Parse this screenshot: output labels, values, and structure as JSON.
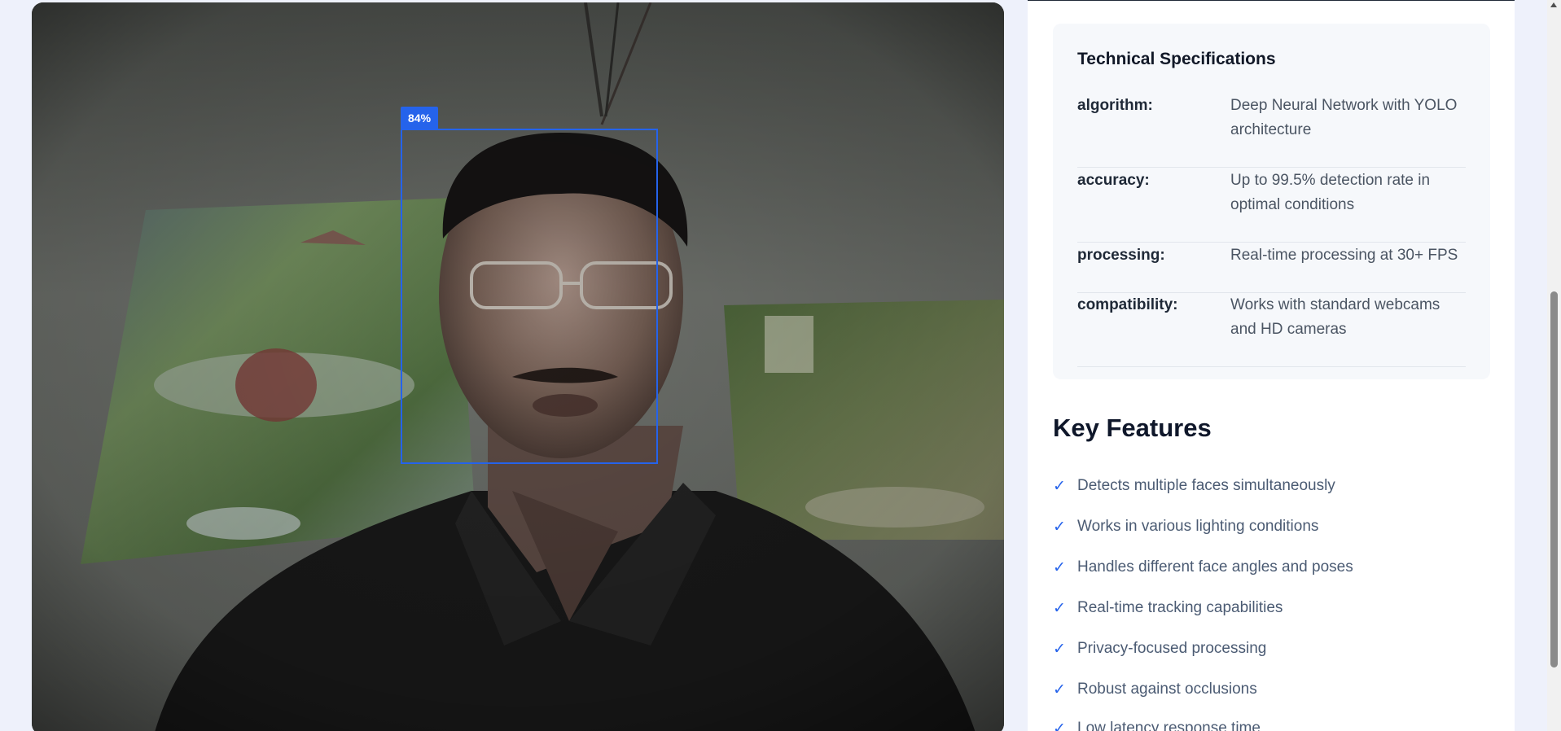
{
  "detection": {
    "confidence_label": "84%"
  },
  "specs": {
    "title": "Technical Specifications",
    "rows": [
      {
        "key": "algorithm:",
        "value": "Deep Neural Network with YOLO architecture"
      },
      {
        "key": "accuracy:",
        "value": "Up to 99.5% detection rate in optimal conditions"
      },
      {
        "key": "processing:",
        "value": "Real-time processing at 30+ FPS"
      },
      {
        "key": "compatibility:",
        "value": "Works with standard webcams and HD cameras"
      }
    ]
  },
  "features": {
    "title": "Key Features",
    "check_glyph": "✓",
    "items": [
      "Detects multiple faces simultaneously",
      "Works in various lighting conditions",
      "Handles different face angles and poses",
      "Real-time tracking capabilities",
      "Privacy-focused processing",
      "Robust against occlusions",
      "Low latency response time"
    ]
  },
  "colors": {
    "accent": "#2563eb",
    "page_bg": "#eef1fb",
    "card_bg": "#f6f8fb"
  },
  "icons": {
    "check": "check-icon",
    "scroll_up": "chevron-up-icon"
  }
}
